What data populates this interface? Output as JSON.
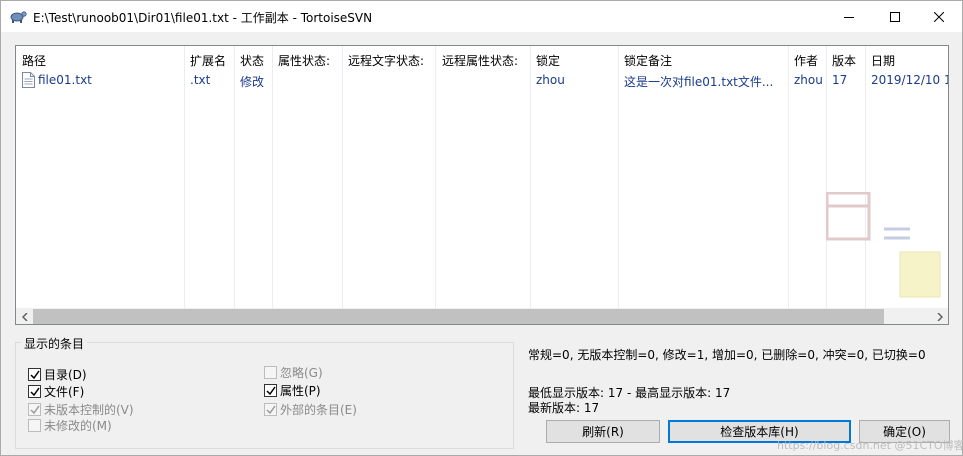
{
  "window": {
    "title": "E:\\Test\\runoob01\\Dir01\\file01.txt - 工作副本 - TortoiseSVN",
    "icon": "tortoise-icon"
  },
  "list": {
    "columns": [
      "路径",
      "扩展名",
      "状态",
      "属性状态:",
      "远程文字状态:",
      "远程属性状态:",
      "锁定",
      "锁定备注",
      "作者",
      "版本",
      "日期"
    ],
    "rows": [
      {
        "path": "file01.txt",
        "ext": ".txt",
        "status": "修改",
        "lock": "zhou",
        "lock_comment": "这是一次对file01.txt文件...",
        "author": "zhou",
        "revision": "17",
        "date": "2019/12/10 1"
      }
    ]
  },
  "display_group": {
    "legend": "显示的条目",
    "items": [
      {
        "label": "目录(D)",
        "checked": true,
        "enabled": true
      },
      {
        "label": "文件(F)",
        "checked": true,
        "enabled": true
      },
      {
        "label": "未版本控制的(V)",
        "checked": true,
        "enabled": false
      },
      {
        "label": "未修改的(M)",
        "checked": false,
        "enabled": false
      },
      {
        "label": "忽略(G)",
        "checked": false,
        "enabled": false
      },
      {
        "label": "属性(P)",
        "checked": true,
        "enabled": true
      },
      {
        "label": "外部的条目(E)",
        "checked": true,
        "enabled": false
      }
    ]
  },
  "summary": {
    "counts": "常规=0, 无版本控制=0, 修改=1, 增加=0, 已删除=0, 冲突=0, 已切换=0",
    "min_max": "最低显示版本: 17 - 最高显示版本: 17",
    "latest": "最新版本: 17"
  },
  "buttons": {
    "refresh": "刷新(R)",
    "check_repo": "检查版本库(H)",
    "ok": "确定(O)"
  },
  "watermark": "https://blog.csdn.net @51CTO博客"
}
